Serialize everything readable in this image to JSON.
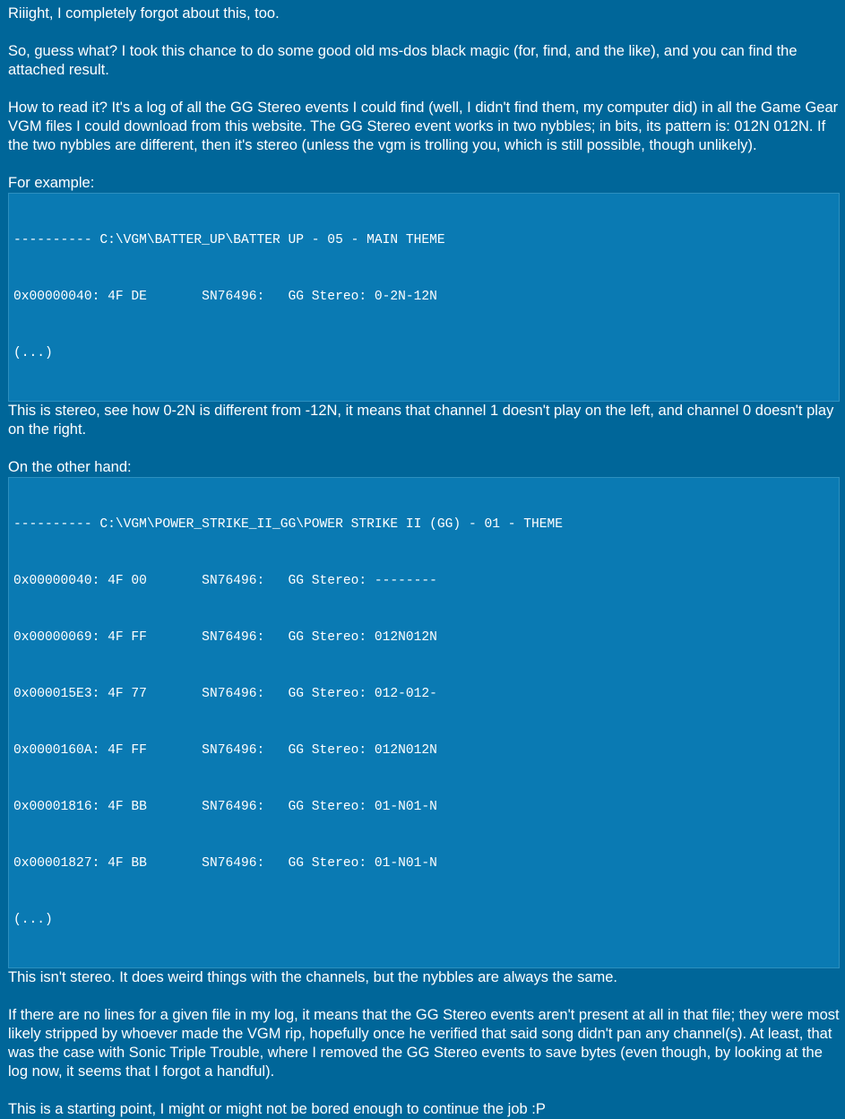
{
  "post": {
    "p1": "Riiight, I completely forgot about this, too.",
    "p2": "So, guess what? I took this chance to do some good old ms-dos black magic (for, find, and the like), and you can find the attached result.",
    "p3": "How to read it? It's a log of all the GG Stereo events I could find (well, I didn't find them, my computer did) in all the Game Gear VGM files I could download from this website. The GG Stereo event works in two nybbles; in bits, its pattern is: 012N 012N. If the two nybbles are different, then it's stereo (unless the vgm is trolling you, which is still possible, though unlikely).",
    "p4": "For example:",
    "code1": [
      "---------- C:\\VGM\\BATTER_UP\\BATTER UP - 05 - MAIN THEME",
      "0x00000040: 4F DE       SN76496:   GG Stereo: 0-2N-12N",
      "(...)"
    ],
    "p5": "This is stereo, see how 0-2N is different from -12N, it means that channel 1 doesn't play on the left, and channel 0 doesn't play on the right.",
    "p6": "On the other hand:",
    "code2": [
      "---------- C:\\VGM\\POWER_STRIKE_II_GG\\POWER STRIKE II (GG) - 01 - THEME",
      "0x00000040: 4F 00       SN76496:   GG Stereo: --------",
      "0x00000069: 4F FF       SN76496:   GG Stereo: 012N012N",
      "0x000015E3: 4F 77       SN76496:   GG Stereo: 012-012-",
      "0x0000160A: 4F FF       SN76496:   GG Stereo: 012N012N",
      "0x00001816: 4F BB       SN76496:   GG Stereo: 01-N01-N",
      "0x00001827: 4F BB       SN76496:   GG Stereo: 01-N01-N",
      "(...)"
    ],
    "p7": "This isn't stereo. It does weird things with the channels, but the nybbles are always the same.",
    "p8": "If there are no lines for a given file in my log, it means that the GG Stereo events aren't present at all in that file; they were most likely stripped by whoever made the VGM rip, hopefully once he verified that said song didn't pan any channel(s). At least, that was the case with Sonic Triple Trouble, where I removed the GG Stereo events to save bytes (even though, by looking at the log now, it seems that I forgot a handful).",
    "p9": "This is a starting point, I might or might not be bored enough to continue the job :P"
  },
  "colors": {
    "background": "#006699",
    "code_background": "#0a7ab3",
    "text": "#ffffff"
  }
}
